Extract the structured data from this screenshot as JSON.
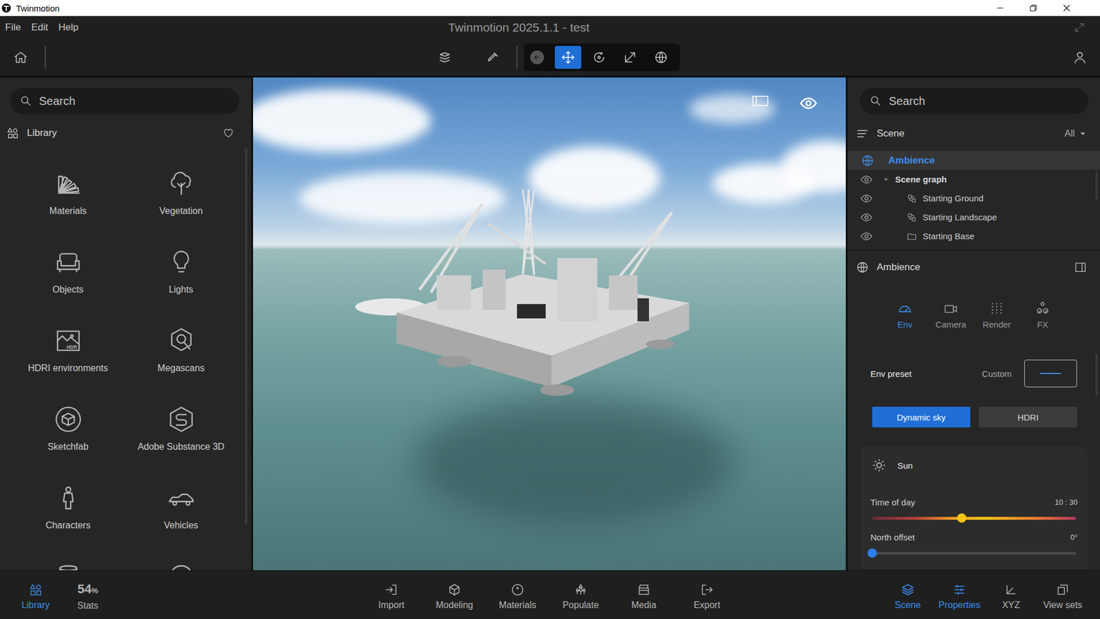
{
  "window": {
    "title": "Twinmotion",
    "app_title": "Twinmotion 2025.1.1 - test"
  },
  "menu": [
    "File",
    "Edit",
    "Help"
  ],
  "toolbar": {
    "tools": [
      {
        "selected": false,
        "disabled": false
      },
      {
        "selected": false,
        "disabled": false
      }
    ],
    "transform_tools": [
      {
        "selected": false,
        "disabled": true
      },
      {
        "selected": true,
        "disabled": false
      },
      {
        "selected": false,
        "disabled": false
      },
      {
        "selected": false,
        "disabled": false
      },
      {
        "selected": false,
        "disabled": false
      }
    ]
  },
  "library": {
    "search_placeholder": "Search",
    "title": "Library",
    "items": [
      {
        "label": "Materials"
      },
      {
        "label": "Vegetation"
      },
      {
        "label": "Objects"
      },
      {
        "label": "Lights"
      },
      {
        "label": "HDRI environments",
        "badge": "HDR"
      },
      {
        "label": "Megascans"
      },
      {
        "label": "Sketchfab"
      },
      {
        "label": "Adobe Substance 3D"
      },
      {
        "label": "Characters"
      },
      {
        "label": "Vehicles"
      },
      {
        "label": ""
      },
      {
        "label": ""
      }
    ]
  },
  "scene": {
    "search_placeholder": "Search",
    "title": "Scene",
    "filter": "All",
    "items": [
      {
        "label": "Ambience",
        "kind": "ambience",
        "selected": true,
        "expanded": false
      },
      {
        "label": "Scene graph",
        "kind": "group",
        "selected": false,
        "expanded": true,
        "visible": true
      },
      {
        "label": "Starting Ground",
        "kind": "object",
        "selected": false,
        "expanded": false,
        "visible": true
      },
      {
        "label": "Starting Landscape",
        "kind": "object",
        "selected": false,
        "expanded": false,
        "visible": true
      },
      {
        "label": "Starting Base",
        "kind": "folder",
        "selected": false,
        "expanded": false,
        "visible": true
      }
    ]
  },
  "ambience": {
    "title": "Ambience",
    "tabs": [
      {
        "label": "Env",
        "selected": true
      },
      {
        "label": "Camera",
        "selected": false
      },
      {
        "label": "Render",
        "selected": false
      },
      {
        "label": "FX",
        "selected": false
      }
    ],
    "env_preset": {
      "label": "Env preset",
      "value": "Custom"
    },
    "sky_modes": [
      {
        "label": "Dynamic sky",
        "selected": true
      },
      {
        "label": "HDRI",
        "selected": false
      }
    ],
    "sun": {
      "title": "Sun",
      "sliders": [
        {
          "label": "Time of day",
          "reading": "10 : 30",
          "level": 0.44,
          "kind": "gradient"
        },
        {
          "label": "North offset",
          "reading": "0°",
          "level": 0,
          "kind": "plain"
        }
      ]
    }
  },
  "bottom_bar": {
    "left": [
      {
        "label": "Library",
        "selected": true
      }
    ],
    "stats": {
      "value": "54",
      "unit": "%",
      "label": "Stats"
    },
    "center": [
      {
        "label": "Import",
        "selected": false
      },
      {
        "label": "Modeling",
        "selected": false
      },
      {
        "label": "Materials",
        "selected": false
      },
      {
        "label": "Populate",
        "selected": false
      },
      {
        "label": "Media",
        "selected": false
      },
      {
        "label": "Export",
        "selected": false
      }
    ],
    "right": [
      {
        "label": "Scene",
        "selected": true
      },
      {
        "label": "Properties",
        "selected": true
      },
      {
        "label": "XYZ",
        "selected": false
      },
      {
        "label": "View sets",
        "selected": false
      }
    ]
  }
}
